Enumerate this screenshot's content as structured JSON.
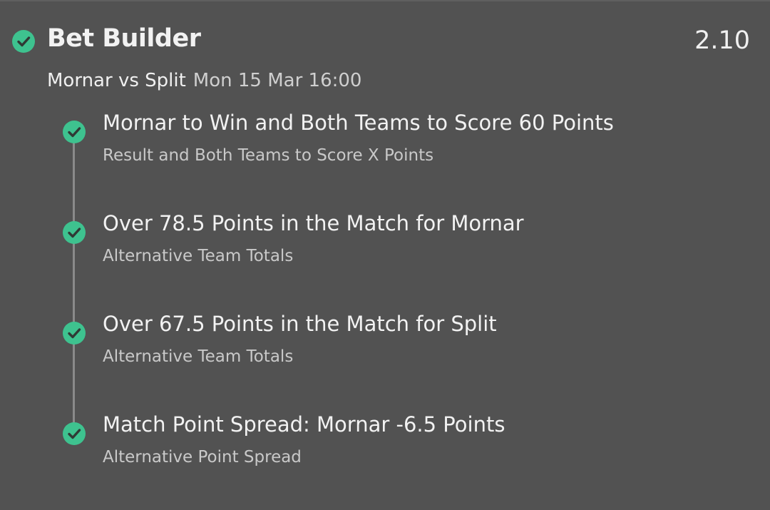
{
  "bet": {
    "title": "Bet Builder",
    "odds": "2.10",
    "match": "Mornar vs Split",
    "datetime": "Mon 15 Mar 16:00"
  },
  "legs": [
    {
      "selection": "Mornar to Win and Both Teams to Score 60 Points",
      "market": "Result and Both Teams to Score X Points"
    },
    {
      "selection": "Over 78.5 Points in the Match for Mornar",
      "market": "Alternative Team Totals"
    },
    {
      "selection": "Over 67.5 Points in the Match for Split",
      "market": "Alternative Team Totals"
    },
    {
      "selection": "Match Point Spread: Mornar -6.5 Points",
      "market": "Alternative Point Spread"
    }
  ],
  "colors": {
    "background": "#525252",
    "check": "#3ec28f",
    "text_primary": "#f2f2f2",
    "text_secondary": "#c9c9c9"
  },
  "icons": {
    "status": "check-circle-icon"
  }
}
